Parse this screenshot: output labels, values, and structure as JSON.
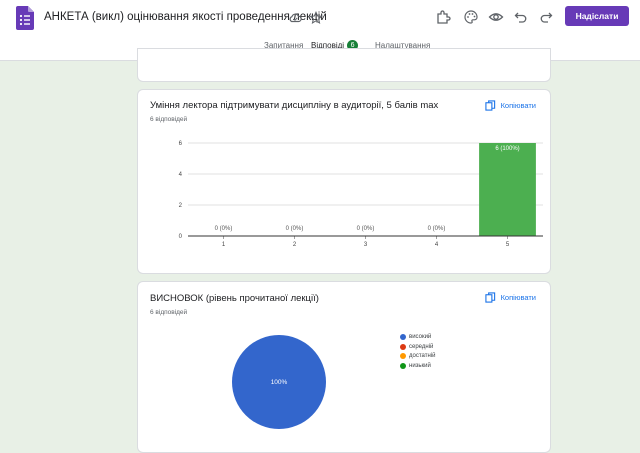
{
  "header": {
    "title": "АНКЕТА (викл) оцінювання якості проведення лекцій",
    "send_label": "Надіслати"
  },
  "tabs": [
    {
      "label": "Запитання"
    },
    {
      "label": "Відповіді",
      "badge": "6"
    },
    {
      "label": "Налаштування"
    }
  ],
  "cards": {
    "discipline": {
      "title": "Уміння лектора підтримувати дисципліну в аудиторії, 5 балів max",
      "responses": "6 відповідей",
      "copy_label": "Копіювати"
    },
    "conclusion": {
      "title": "ВИСНОВОК (рівень прочитаної лекції)",
      "responses": "6 відповідей",
      "copy_label": "Копіювати"
    }
  },
  "chart_data": [
    {
      "type": "bar",
      "categories": [
        "1",
        "2",
        "3",
        "4",
        "5"
      ],
      "values": [
        0,
        0,
        0,
        0,
        6
      ],
      "data_labels": [
        "0 (0%)",
        "0 (0%)",
        "0 (0%)",
        "0 (0%)",
        "6 (100%)"
      ],
      "ylim": [
        0,
        6
      ],
      "yticks": [
        "0",
        "2",
        "4",
        "6"
      ],
      "color": "#4caf50"
    },
    {
      "type": "pie",
      "categories": [
        "високий",
        "середній",
        "достатній",
        "низький"
      ],
      "values": [
        6,
        0,
        0,
        0
      ],
      "slice_label": "100%",
      "colors": [
        "#3366cc",
        "#dc3912",
        "#ff9900",
        "#109618"
      ]
    }
  ]
}
